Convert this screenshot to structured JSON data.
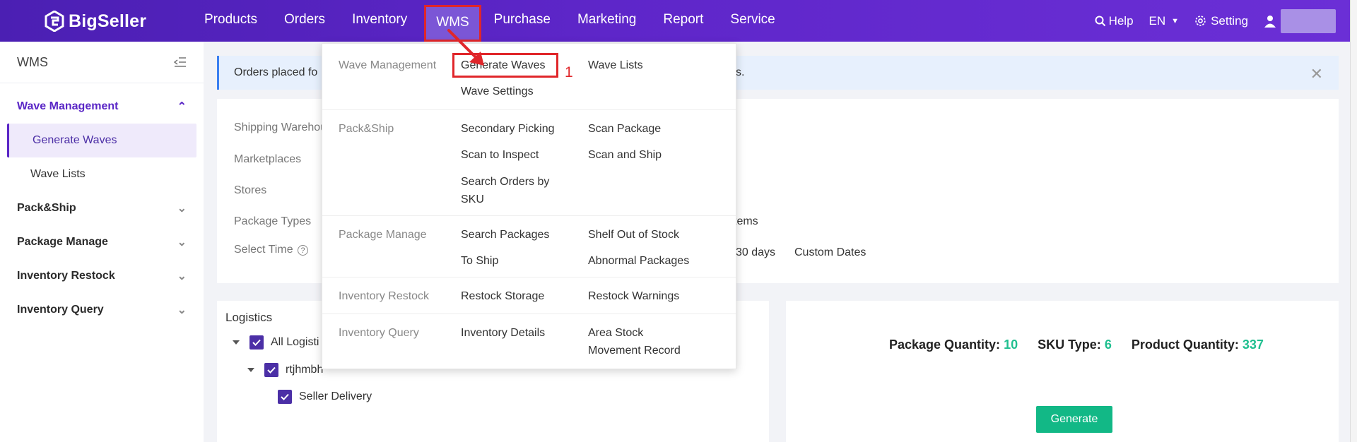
{
  "app": {
    "name": "BigSeller"
  },
  "nav": {
    "items": [
      "Products",
      "Orders",
      "Inventory",
      "WMS",
      "Purchase",
      "Marketing",
      "Report",
      "Service"
    ],
    "active": "WMS"
  },
  "top_right": {
    "help": "Help",
    "language": "EN",
    "setting": "Setting"
  },
  "sidebar": {
    "title": "WMS",
    "groups": [
      {
        "label": "Wave Management",
        "items": [
          "Generate Waves",
          "Wave Lists"
        ]
      },
      {
        "label": "Pack&Ship"
      },
      {
        "label": "Package Manage"
      },
      {
        "label": "Inventory Restock"
      },
      {
        "label": "Inventory Query"
      }
    ]
  },
  "notice": {
    "text_start": "Orders placed fo",
    "text_end": "s."
  },
  "filters": {
    "labels": [
      "Shipping Warehou",
      "Marketplaces",
      "Stores",
      "Package Types",
      "Select Time"
    ],
    "extras": {
      "items": "tems",
      "last30": "30 days",
      "custom": "Custom Dates"
    }
  },
  "logistics": {
    "title": "Logistics",
    "tree": [
      "All Logisti",
      "rtjhmbh",
      "Seller Delivery"
    ]
  },
  "generate": {
    "package_quantity_label": "Package Quantity:",
    "package_quantity": "10",
    "sku_type_label": "SKU Type:",
    "sku_type": "6",
    "product_quantity_label": "Product Quantity:",
    "product_quantity": "337",
    "button": "Generate"
  },
  "dropdown": {
    "wave_management": {
      "label": "Wave Management",
      "links": [
        "Generate Waves",
        "Wave Lists",
        "Wave Settings"
      ]
    },
    "pack_ship": {
      "label": "Pack&Ship",
      "links": [
        "Secondary Picking",
        "Scan Package",
        "Scan to Inspect",
        "Scan and Ship",
        "Search Orders by",
        "SKU"
      ]
    },
    "package_manage": {
      "label": "Package Manage",
      "links": [
        "Search Packages",
        "Shelf Out of Stock",
        "To Ship",
        "Abnormal Packages"
      ]
    },
    "inventory_restock": {
      "label": "Inventory Restock",
      "links": [
        "Restock Storage",
        "Restock Warnings"
      ]
    },
    "inventory_query": {
      "label": "Inventory Query",
      "links": [
        "Inventory Details",
        "Area Stock",
        "Movement Record"
      ]
    }
  },
  "annotation": {
    "marker": "1",
    "color": "#e0262a"
  },
  "colors": {
    "brand": "#5a26c6",
    "accent_green": "#12b886",
    "notice_blue": "#3b7ff0"
  }
}
